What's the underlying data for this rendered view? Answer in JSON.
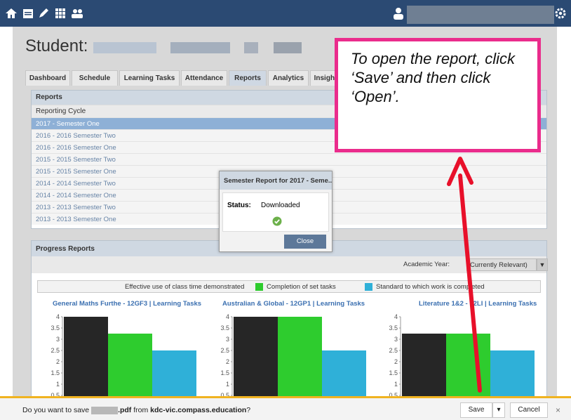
{
  "student": {
    "label": "Student:"
  },
  "tabs": [
    "Dashboard",
    "Schedule",
    "Learning Tasks",
    "Attendance",
    "Reports",
    "Analytics",
    "Insight"
  ],
  "reports": {
    "panel_title": "Reports",
    "column_header": "Reporting Cycle",
    "rows": [
      "2017 - Semester One",
      "2016 - 2016 Semester Two",
      "2016 - 2016 Semester One",
      "2015 - 2015 Semester Two",
      "2015 - 2015 Semester One",
      "2014 - 2014 Semester Two",
      "2014 - 2014 Semester One",
      "2013 - 2013 Semester Two",
      "2013 - 2013 Semester One"
    ]
  },
  "modal": {
    "title": "Semester Report for 2017 - Seme...",
    "status_label": "Status:",
    "status_value": "Downloaded",
    "close_label": "Close"
  },
  "progress": {
    "panel_title": "Progress Reports",
    "academic_year_label": "Academic Year:",
    "academic_year_value": "Currently Relevant)",
    "legend": [
      {
        "label": "Effective use of class time demonstrated",
        "color": "#262626"
      },
      {
        "label": "Completion of set tasks",
        "color": "#2ecc2e"
      },
      {
        "label": "Standard to which work is completed",
        "color": "#2fb0d8"
      }
    ]
  },
  "chart_data": [
    {
      "type": "bar",
      "title": "General Maths Furthe - 12GF3 | Learning Tasks",
      "yticks": [
        "4",
        "3.5",
        "3",
        "2.5",
        "2",
        "1.5",
        "1",
        "0.5"
      ],
      "ylim": [
        0,
        4
      ],
      "series": [
        {
          "name": "Effective use of class time demonstrated",
          "values": [
            4
          ]
        },
        {
          "name": "Completion of set tasks",
          "values": [
            3.25
          ]
        },
        {
          "name": "Standard to which work is completed",
          "values": [
            2.5
          ]
        }
      ]
    },
    {
      "type": "bar",
      "title": "Australian & Global - 12GP1 | Learning Tasks",
      "yticks": [
        "4",
        "3.5",
        "3",
        "2.5",
        "2",
        "1.5",
        "1",
        "0.5"
      ],
      "ylim": [
        0,
        4
      ],
      "series": [
        {
          "name": "Effective use of class time demonstrated",
          "values": [
            4
          ]
        },
        {
          "name": "Completion of set tasks",
          "values": [
            4
          ]
        },
        {
          "name": "Standard to which work is completed",
          "values": [
            2.5
          ]
        }
      ]
    },
    {
      "type": "bar",
      "title": "Literature 1&2 - 12LI | Learning Tasks",
      "yticks": [
        "4",
        "3.5",
        "3",
        "2.5",
        "2",
        "1.5",
        "1",
        "0.5"
      ],
      "ylim": [
        0,
        4
      ],
      "series": [
        {
          "name": "Effective use of class time demonstrated",
          "values": [
            3.25
          ]
        },
        {
          "name": "Completion of set tasks",
          "values": [
            3.25
          ]
        },
        {
          "name": "Standard to which work is completed",
          "values": [
            2.5
          ]
        }
      ]
    }
  ],
  "callout": {
    "text": "To open the report, click ‘Save’ and then click ‘Open’."
  },
  "download_bar": {
    "prefix": "Do you want to save",
    "filename_suffix": ".pdf",
    "from_text": "from",
    "domain": "kdc-vic.compass.education",
    "end": "?",
    "save_label": "Save",
    "dropdown_label": "▾",
    "cancel_label": "Cancel",
    "close_label": "×"
  },
  "icons": [
    "home-icon",
    "calendar-icon",
    "pencil-icon",
    "grid-icon",
    "people-icon",
    "user-icon",
    "gear-icon"
  ],
  "colors": {
    "topbar": "#2b4a73",
    "highlight": "#ea2c8c",
    "arrow": "#e8102a",
    "accent": "#3a6fb0"
  }
}
